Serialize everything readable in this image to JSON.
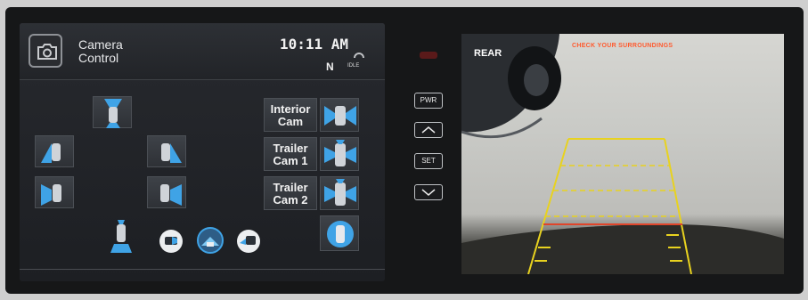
{
  "header": {
    "title_line1": "Camera",
    "title_line2": "Control",
    "time": "10:11 AM",
    "gear": "N",
    "idle_label": "IDLE"
  },
  "camera_grid": {
    "labels": [
      {
        "line1": "Interior",
        "line2": "Cam"
      },
      {
        "line1": "Trailer",
        "line2": "Cam 1"
      },
      {
        "line1": "Trailer",
        "line2": "Cam 2"
      }
    ]
  },
  "side_controls": {
    "pwr": "PWR",
    "set": "SET"
  },
  "camera_view": {
    "view_label": "REAR",
    "warning": "CHECK YOUR SURROUNDINGS"
  },
  "colors": {
    "accent_blue": "#3fa3e6",
    "guide_yellow": "#e8d21f",
    "guide_red": "#e0452a",
    "warning_orange": "#ff5a2e"
  }
}
